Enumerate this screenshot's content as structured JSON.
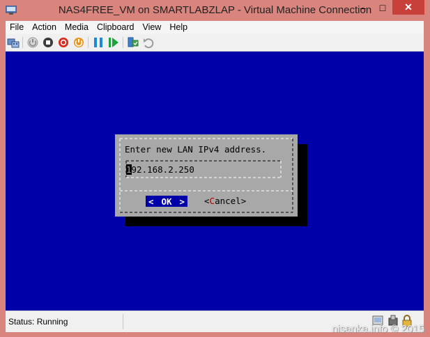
{
  "window": {
    "title": "NAS4FREE_VM on SMARTLABZLAP - Virtual Machine Connection",
    "controls": {
      "minimize": "–",
      "maximize": "□",
      "close": "✕"
    }
  },
  "menu": {
    "items": [
      {
        "label": "File"
      },
      {
        "label": "Action"
      },
      {
        "label": "Media"
      },
      {
        "label": "Clipboard"
      },
      {
        "label": "View"
      },
      {
        "label": "Help"
      }
    ]
  },
  "toolbar": {
    "icons": [
      "ctrl-alt-del-icon",
      "start-icon",
      "turn-off-icon",
      "shutdown-icon",
      "save-state-icon",
      "pause-icon",
      "resume-icon",
      "checkpoint-icon",
      "revert-icon"
    ]
  },
  "dialog": {
    "prompt": "Enter new LAN IPv4 address.",
    "ip_cursor_char": "1",
    "ip_rest": "92.168.2.250",
    "ok_label": "OK",
    "ok_left": "<",
    "ok_right": ">",
    "cancel_open": "<",
    "cancel_hot": "C",
    "cancel_rest": "ancel>"
  },
  "status": {
    "text": "Status: Running"
  },
  "watermark": "nisanka.info © 2015",
  "colors": {
    "screen": "#0000a8",
    "dialog": "#a8a8a8",
    "titlebar": "#d9857e",
    "close": "#c7403a"
  }
}
